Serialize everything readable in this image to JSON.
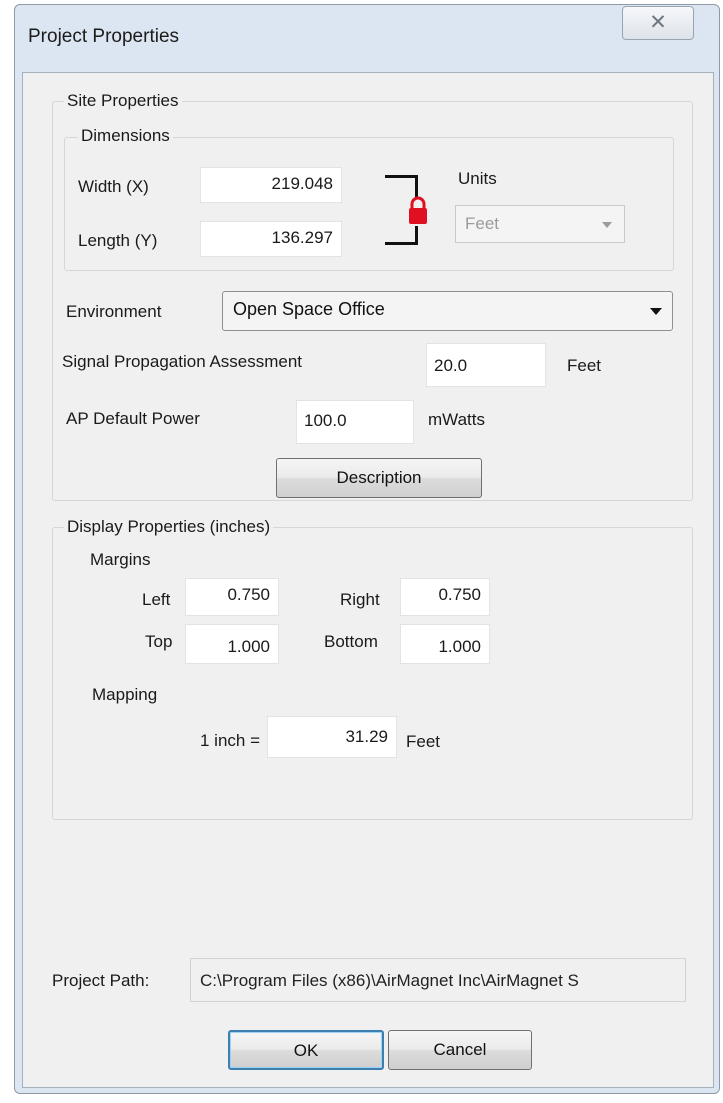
{
  "window": {
    "title": "Project Properties",
    "close_glyph": "✕"
  },
  "site": {
    "group_label": "Site Properties",
    "dimensions": {
      "group_label": "Dimensions",
      "width_label": "Width (X)",
      "width_value": "219.048",
      "length_label": "Length (Y)",
      "length_value": "136.297",
      "units_label": "Units",
      "units_value": "Feet",
      "lock_icon": "padlock-icon",
      "lock_color": "#e01020"
    },
    "environment_label": "Environment",
    "environment_value": "Open Space Office",
    "signal_label": "Signal Propagation Assessment",
    "signal_value": "20.0",
    "signal_unit": "Feet",
    "ap_power_label": "AP Default Power",
    "ap_power_value": "100.0",
    "ap_power_unit": "mWatts",
    "description_button": "Description"
  },
  "display": {
    "group_label": "Display Properties (inches)",
    "margins_label": "Margins",
    "left_label": "Left",
    "left_value": "0.750",
    "right_label": "Right",
    "right_value": "0.750",
    "top_label": "Top",
    "top_value": "1.000",
    "bottom_label": "Bottom",
    "bottom_value": "1.000",
    "mapping_label": "Mapping",
    "inch_label": "1 inch =",
    "inch_value": "31.29",
    "inch_unit": "Feet"
  },
  "project_path": {
    "label": "Project Path:",
    "value": "C:\\Program Files (x86)\\AirMagnet Inc\\AirMagnet S"
  },
  "buttons": {
    "ok": "OK",
    "cancel": "Cancel"
  }
}
